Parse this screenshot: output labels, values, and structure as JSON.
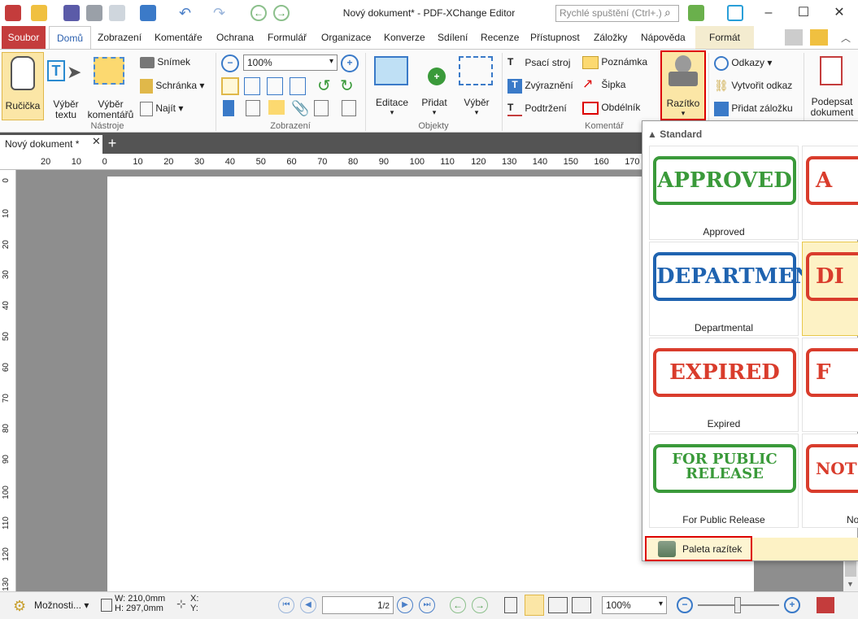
{
  "window": {
    "title": "Nový dokument* - PDF-XChange Editor",
    "search_placeholder": "Rychlé spuštění (Ctrl+.)"
  },
  "tabs": [
    {
      "label": "Soubor"
    },
    {
      "label": "Domů"
    },
    {
      "label": "Zobrazení"
    },
    {
      "label": "Komentáře"
    },
    {
      "label": "Ochrana"
    },
    {
      "label": "Formulář"
    },
    {
      "label": "Organizace"
    },
    {
      "label": "Konverze"
    },
    {
      "label": "Sdílení"
    },
    {
      "label": "Recenze"
    },
    {
      "label": "Přístupnost"
    },
    {
      "label": "Záložky"
    },
    {
      "label": "Nápověda"
    },
    {
      "label": "Formát"
    }
  ],
  "ribbon": {
    "tools": {
      "label": "Nástroje",
      "hand": "Ručička",
      "text_sel": "Výběr textu",
      "comment_sel": "Výběr komentářů",
      "snapshot": "Snímek",
      "clipboard": "Schránka",
      "find": "Najít"
    },
    "view": {
      "label": "Zobrazení",
      "zoom": "100%"
    },
    "objects": {
      "label": "Objekty",
      "edit": "Editace",
      "add": "Přidat",
      "select": "Výběr"
    },
    "comment": {
      "label": "Komentář",
      "typewriter": "Psací stroj",
      "highlight": "Zvýraznění",
      "underline": "Podtržení",
      "note": "Poznámka",
      "arrow": "Šipka",
      "rect": "Obdélník",
      "stamp": "Razítko"
    },
    "links": {
      "links": "Odkazy",
      "create_link": "Vytvořit odkaz",
      "add_bookmark": "Přidat záložku"
    },
    "sign": {
      "label": "Podepsat dokument"
    }
  },
  "document": {
    "tab_name": "Nový dokument *"
  },
  "ruler": {
    "h": [
      "20",
      "10",
      "0",
      "10",
      "20",
      "30",
      "40",
      "50",
      "60",
      "70",
      "80",
      "90",
      "100",
      "110",
      "120",
      "130",
      "140",
      "150",
      "160",
      "170"
    ],
    "v": [
      "0",
      "10",
      "20",
      "30",
      "40",
      "50",
      "60",
      "70",
      "80",
      "90",
      "100",
      "110",
      "120",
      "130"
    ]
  },
  "stamps": {
    "header": "Standard",
    "items": [
      {
        "text": "APPROVED",
        "caption": "Approved",
        "color": "#3a9a3a"
      },
      {
        "text": "DEPARTMENTAL",
        "caption": "Departmental",
        "color": "#1f63b0"
      },
      {
        "text": "EXPIRED",
        "caption": "Expired",
        "color": "#d93c2c"
      },
      {
        "text": "FOR PUBLIC RELEASE",
        "caption": "For Public Release",
        "color": "#3a9a3a"
      }
    ],
    "partial": [
      {
        "text": "A",
        "caption": ""
      },
      {
        "text": "DI",
        "caption": ""
      },
      {
        "text": "F",
        "caption": ""
      },
      {
        "text": "NOT A",
        "caption": "No"
      }
    ],
    "palette": "Paleta razítek"
  },
  "status": {
    "options": "Možnosti...",
    "w": "W: 210,0mm",
    "h": "H: 297,0mm",
    "x": "X:",
    "y": "Y:",
    "page": "1",
    "pages": "/2",
    "zoom": "100%"
  }
}
